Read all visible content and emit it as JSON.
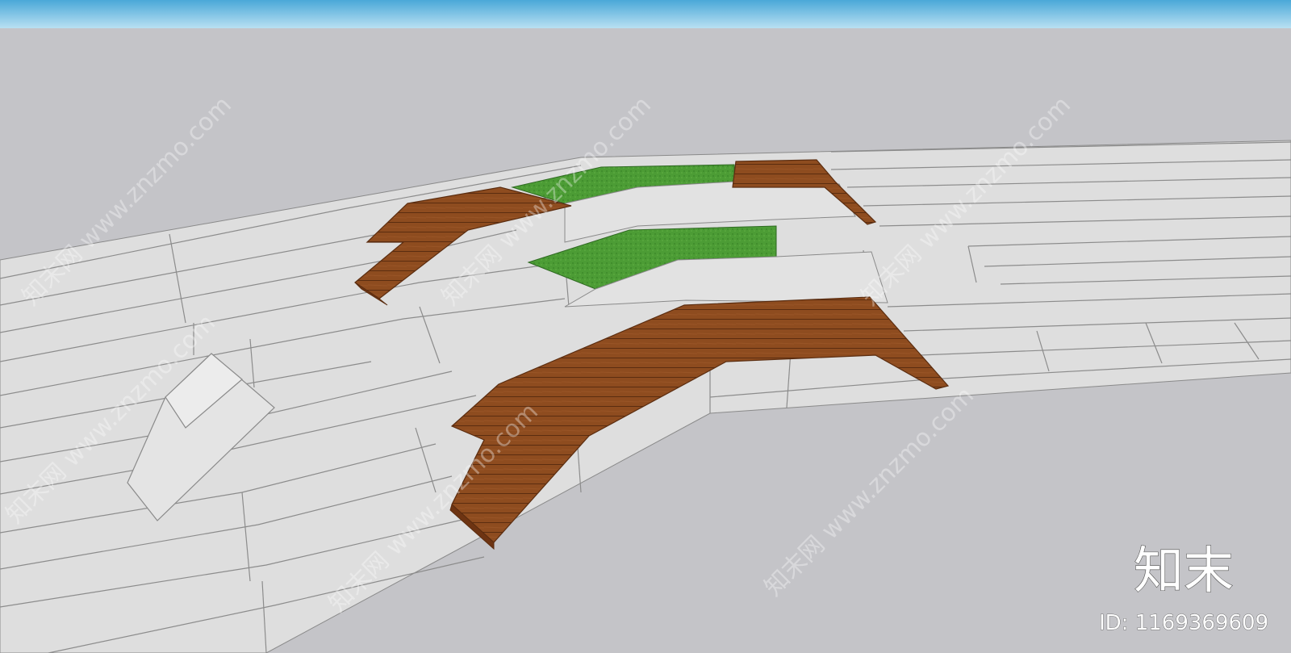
{
  "watermark": {
    "logo": "知末",
    "id_label": "ID: 1169369609",
    "site": "知末网 www.znzmo.com"
  },
  "colors": {
    "sky_top": "#5fb4dc",
    "background": "#c4c4c8",
    "stone": "#dcdcdc",
    "stone_dark": "#c9c9c9",
    "wood": "#8a4a1e",
    "wood_light": "#a25a26",
    "grass": "#4a9a33"
  }
}
